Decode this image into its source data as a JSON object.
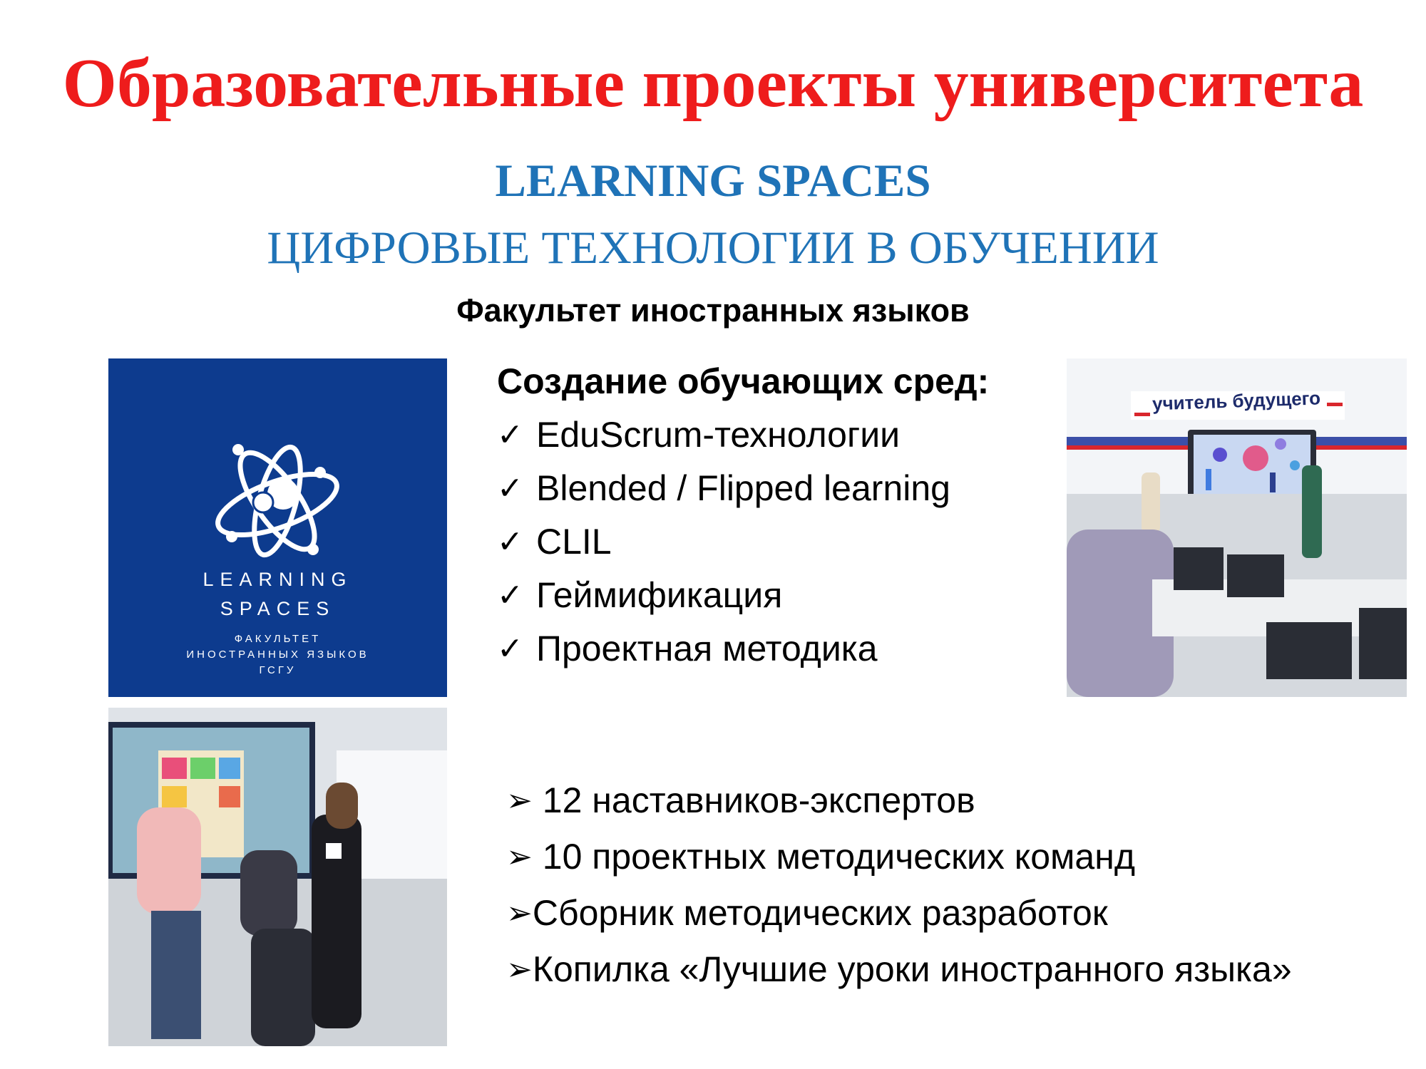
{
  "slide": {
    "title": "Образовательные проекты университета",
    "subtitle_en": "LEARNING SPACES",
    "subtitle_ru": "ЦИФРОВЫЕ ТЕХНОЛОГИИ В ОБУЧЕНИИ",
    "faculty": "Факультет иностранных языков"
  },
  "logo": {
    "line1": "LEARNING",
    "line2": "SPACES",
    "small1": "ФАКУЛЬТЕТ",
    "small2": "ИНОСТРАННЫХ ЯЗЫКОВ",
    "small3": "ГСГУ",
    "background_color": "#0d3b8e"
  },
  "environments": {
    "heading": "Создание обучающих сред:",
    "check_symbol": "✓",
    "items": [
      "EduScrum-технологии",
      "Blended / Flipped learning",
      "CLIL",
      "Геймификация",
      "Проектная методика"
    ]
  },
  "photo_right": {
    "sign_text": "учитель будущего"
  },
  "achievements": {
    "arrow_symbol": "➢",
    "items": [
      " 12 наставников-экспертов",
      " 10 проектных методических команд",
      "Сборник методических разработок",
      "Копилка «Лучшие уроки иностранного языка»"
    ]
  },
  "colors": {
    "title": "#ee1c1c",
    "subtitle": "#1f73b7",
    "text": "#000000"
  }
}
